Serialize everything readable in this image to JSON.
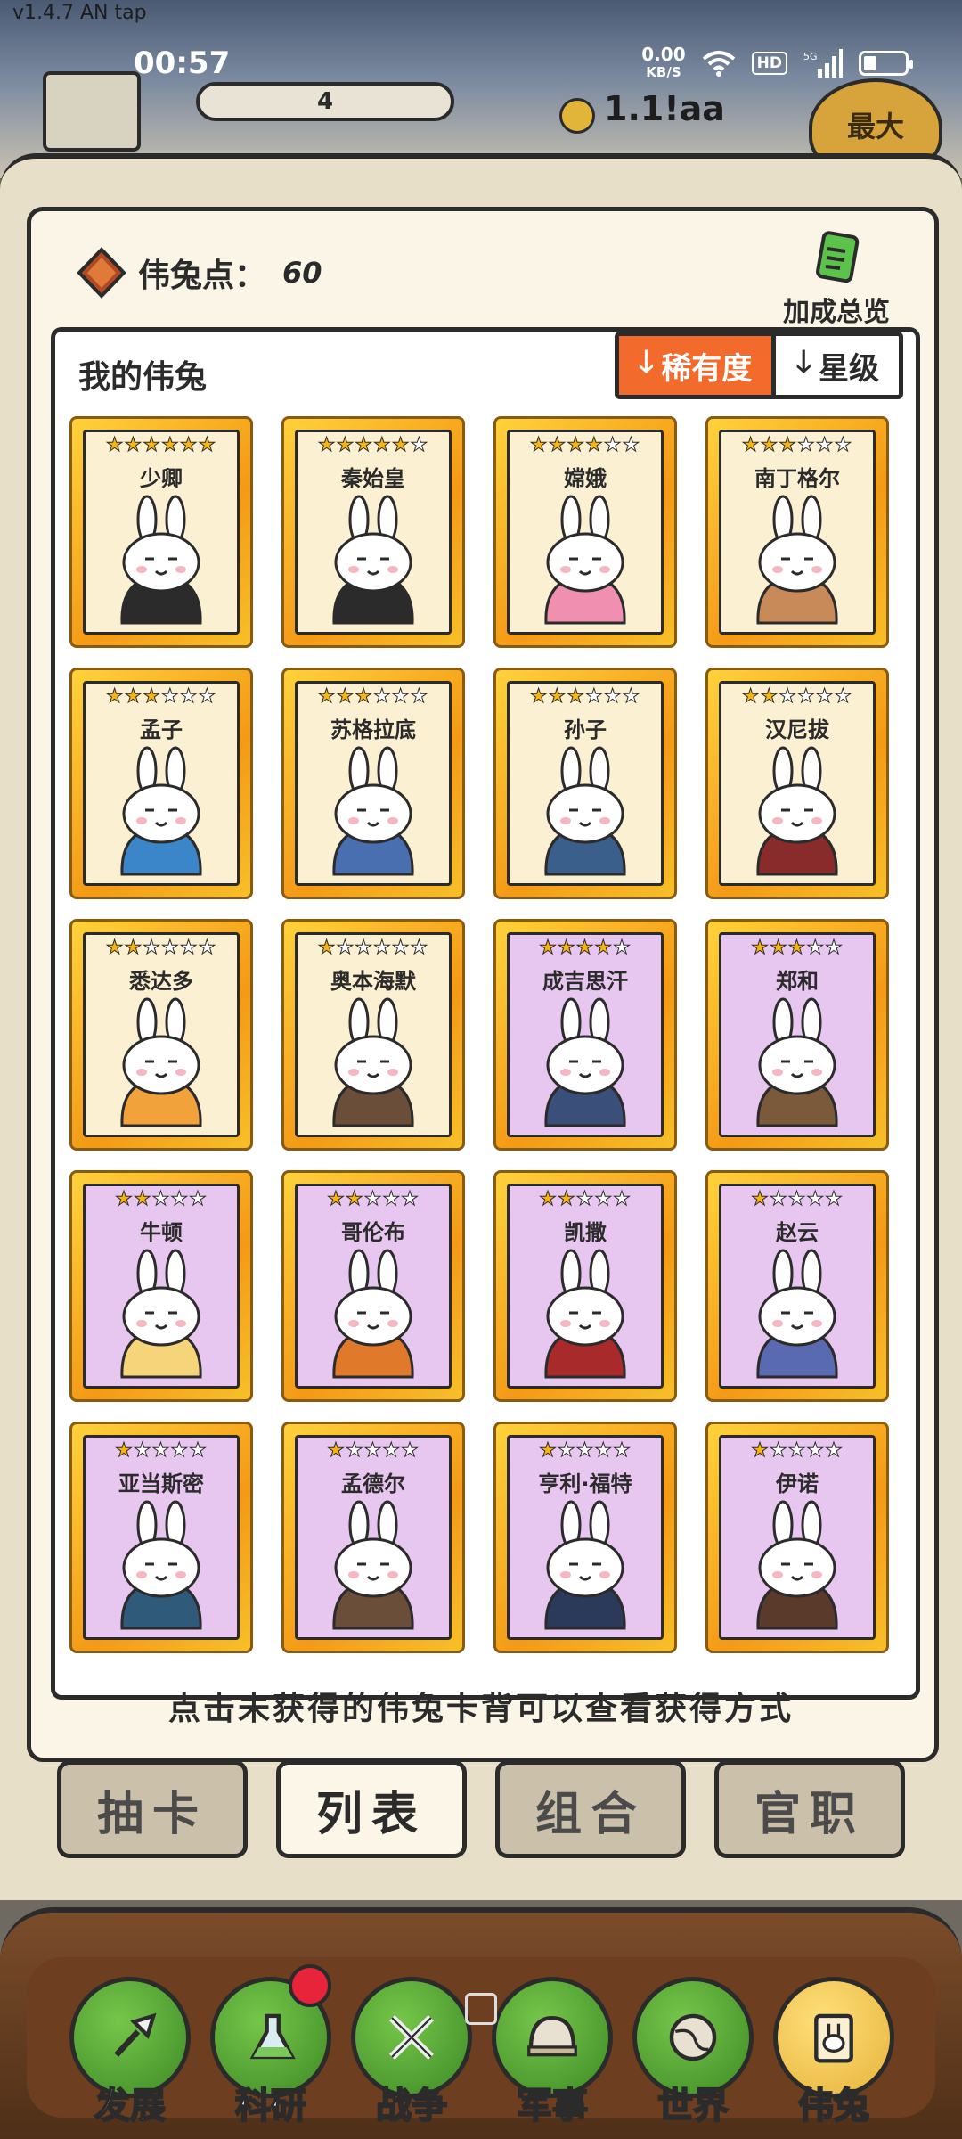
{
  "status": {
    "version": "v1.4.7 AN tap",
    "time": "00:57",
    "net_speed": "0.00",
    "net_unit": "KB/S",
    "hd": "HD"
  },
  "background": {
    "bar_value": "4",
    "coin_text": "1.1!aa",
    "max_label": "最大"
  },
  "panel": {
    "points_label": "伟兔点：",
    "points_value": "60",
    "bonus_label": "加成总览",
    "list_title": "我的伟兔",
    "sort_rarity": "稀有度",
    "sort_star": "星级",
    "hint": "点击未获得的伟兔卡背可以查看获得方式"
  },
  "cards": [
    {
      "name": "少卿",
      "stars": 6,
      "filled": 6,
      "tier": "gold",
      "colors": [
        "#ffffff",
        "#2b2b2b"
      ]
    },
    {
      "name": "秦始皇",
      "stars": 6,
      "filled": 5,
      "tier": "gold",
      "colors": [
        "#ffffff",
        "#2b2b2b"
      ]
    },
    {
      "name": "嫦娥",
      "stars": 6,
      "filled": 4,
      "tier": "gold",
      "colors": [
        "#ffffff",
        "#f08fb0"
      ]
    },
    {
      "name": "南丁格尔",
      "stars": 6,
      "filled": 3,
      "tier": "gold",
      "colors": [
        "#ffffff",
        "#c98a5a"
      ]
    },
    {
      "name": "孟子",
      "stars": 6,
      "filled": 3,
      "tier": "gold",
      "colors": [
        "#ffffff",
        "#3a86c8"
      ]
    },
    {
      "name": "苏格拉底",
      "stars": 6,
      "filled": 3,
      "tier": "gold",
      "colors": [
        "#ffffff",
        "#4a6fb0"
      ]
    },
    {
      "name": "孙子",
      "stars": 6,
      "filled": 3,
      "tier": "gold",
      "colors": [
        "#ffffff",
        "#3a5f8a"
      ]
    },
    {
      "name": "汉尼拔",
      "stars": 6,
      "filled": 2,
      "tier": "gold",
      "colors": [
        "#ffffff",
        "#8a2b2b"
      ]
    },
    {
      "name": "悉达多",
      "stars": 6,
      "filled": 2,
      "tier": "gold",
      "colors": [
        "#ffffff",
        "#f2a23a"
      ]
    },
    {
      "name": "奥本海默",
      "stars": 6,
      "filled": 1,
      "tier": "gold",
      "colors": [
        "#ffffff",
        "#6a4e3a"
      ]
    },
    {
      "name": "成吉思汗",
      "stars": 5,
      "filled": 4,
      "tier": "purple",
      "colors": [
        "#ffffff",
        "#3a4f7a"
      ]
    },
    {
      "name": "郑和",
      "stars": 5,
      "filled": 3,
      "tier": "purple",
      "colors": [
        "#ffffff",
        "#7a5a3a"
      ]
    },
    {
      "name": "牛顿",
      "stars": 5,
      "filled": 2,
      "tier": "purple",
      "colors": [
        "#ffffff",
        "#f5d47a"
      ]
    },
    {
      "name": "哥伦布",
      "stars": 5,
      "filled": 2,
      "tier": "purple",
      "colors": [
        "#ffffff",
        "#e07a2a"
      ]
    },
    {
      "name": "凯撒",
      "stars": 5,
      "filled": 2,
      "tier": "purple",
      "colors": [
        "#ffffff",
        "#a82a2a"
      ]
    },
    {
      "name": "赵云",
      "stars": 5,
      "filled": 1,
      "tier": "purple",
      "colors": [
        "#ffffff",
        "#5a6ab0"
      ]
    },
    {
      "name": "亚当斯密",
      "stars": 5,
      "filled": 1,
      "tier": "purple",
      "colors": [
        "#ffffff",
        "#2f5a7a"
      ]
    },
    {
      "name": "孟德尔",
      "stars": 5,
      "filled": 1,
      "tier": "purple",
      "colors": [
        "#ffffff",
        "#6a4e3a"
      ]
    },
    {
      "name": "亨利·福特",
      "stars": 5,
      "filled": 1,
      "tier": "purple",
      "colors": [
        "#ffffff",
        "#2b3a5a"
      ]
    },
    {
      "name": "伊诺",
      "stars": 5,
      "filled": 1,
      "tier": "purple",
      "colors": [
        "#ffffff",
        "#5a3a2a"
      ]
    }
  ],
  "tabs": [
    {
      "label": "抽卡",
      "active": false
    },
    {
      "label": "列表",
      "active": true
    },
    {
      "label": "组合",
      "active": false
    },
    {
      "label": "官职",
      "active": false
    }
  ],
  "nav": [
    {
      "label": "发展",
      "icon": "shovel-icon",
      "active": false,
      "badge": false
    },
    {
      "label": "科研",
      "icon": "flask-icon",
      "active": false,
      "badge": true
    },
    {
      "label": "战争",
      "icon": "crossed-swords-icon",
      "active": false,
      "badge": false
    },
    {
      "label": "军事",
      "icon": "helmet-icon",
      "active": false,
      "badge": false
    },
    {
      "label": "世界",
      "icon": "globe-icon",
      "active": false,
      "badge": false
    },
    {
      "label": "伟兔",
      "icon": "bunny-card-icon",
      "active": true,
      "badge": false
    }
  ],
  "colors": {
    "accent": "#f26b2c",
    "gold_card": "#fbf0d2",
    "purple_card": "#e7c6ef",
    "nav_green": "#76c64a",
    "badge_red": "#e8243a"
  }
}
